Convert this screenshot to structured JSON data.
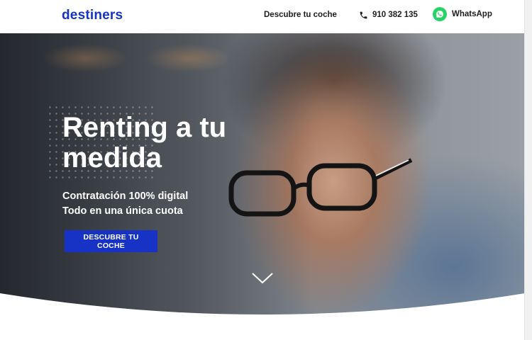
{
  "header": {
    "logo": "destiners",
    "nav_link": "Descubre tu coche",
    "phone": "910 382 135",
    "whatsapp": "WhatsApp",
    "icons": {
      "phone": "phone-icon",
      "whatsapp": "whatsapp-icon"
    }
  },
  "hero": {
    "title": "Renting a tu medida",
    "subtitle_line1": "Contratación 100% digital",
    "subtitle_line2": "Todo en una única cuota",
    "cta_label": "DESCUBRE TU COCHE",
    "scroll_icon": "chevron-down-icon"
  },
  "colors": {
    "brand": "#1733c6",
    "whatsapp": "#25d366",
    "text_dark": "#1d1d1d",
    "hero_text": "#ffffff"
  }
}
